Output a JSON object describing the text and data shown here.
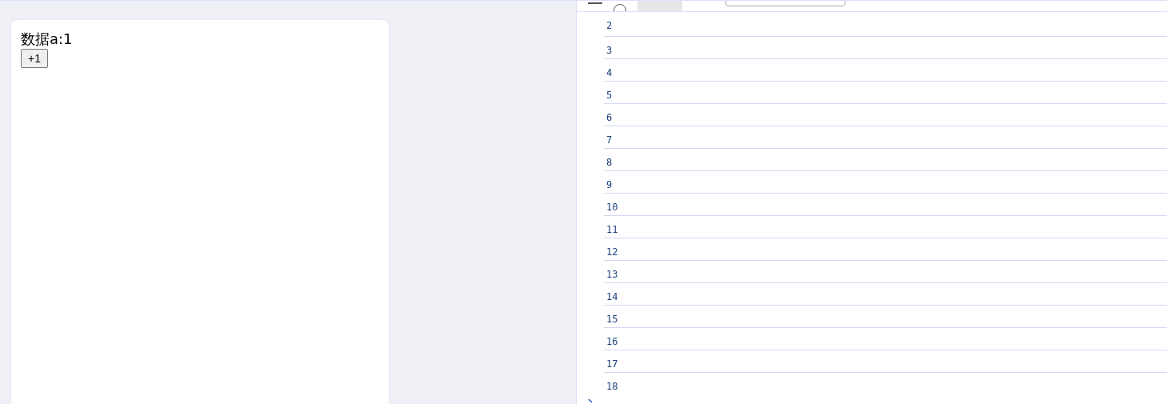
{
  "preview": {
    "label": "数据a:1",
    "button": "+1"
  },
  "console": {
    "messages": [
      "2",
      "3",
      "4",
      "5",
      "6",
      "7",
      "8",
      "9",
      "10",
      "11",
      "12",
      "13",
      "14",
      "15",
      "16",
      "17",
      "18"
    ]
  }
}
